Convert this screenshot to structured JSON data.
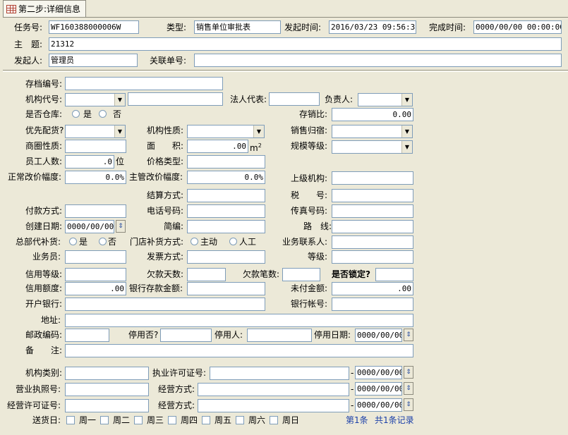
{
  "tab": {
    "title": "第二步:详细信息"
  },
  "header": {
    "task_no_label": "任务号:",
    "task_no": "WF160388000006W",
    "type_label": "类型:",
    "type": "销售单位审批表",
    "start_label": "发起时间:",
    "start_time": "2016/03/23 09:56:30",
    "finish_label": "完成时间:",
    "finish_time": "0000/00/00 00:00:00",
    "subject_label": "主　题:",
    "subject": "21312",
    "initiator_label": "发起人:",
    "initiator": "管理员",
    "related_label": "关联单号:",
    "related": ""
  },
  "form": {
    "archive_no": "存档编号:",
    "org_code": "机构代号:",
    "legal_rep": "法人代表:",
    "manager": "负责人:",
    "is_warehouse": "是否仓库:",
    "yes": "是",
    "no": "否",
    "stock_ratio": "存销比:",
    "stock_ratio_val": "0.00",
    "priority": "优先配货?",
    "org_nature": "机构性质:",
    "sales_attr": "销售归宿:",
    "district": "商圈性质:",
    "area": "面　　积:",
    "area_val": ".00",
    "area_unit": "m",
    "area_sup": "2",
    "scale": "规模等级:",
    "staff": "员工人数:",
    "staff_val": ".0",
    "staff_unit": "位",
    "price_type": "价格类型:",
    "normal_adj": "正常改价幅度:",
    "normal_adj_val": "0.0%",
    "sup_adj": "主管改价幅度:",
    "sup_adj_val": "0.0%",
    "parent": "上级机构:",
    "settle": "结算方式:",
    "tax": "税　　号:",
    "pay": "付款方式:",
    "phone": "电话号码:",
    "fax": "传真号码:",
    "created": "创建日期:",
    "created_val": "0000/00/00",
    "postal": "简编:",
    "route": "路　线:",
    "hq_replenish": "总部代补货:",
    "store_replenish": "门店补货方式:",
    "auto": "主动",
    "manual": "人工",
    "biz_contact": "业务联系人:",
    "salesman": "业务员:",
    "invoice": "发票方式:",
    "grade": "等级:",
    "credit_grade": "信用等级:",
    "overdue_days": "欠款天数:",
    "overdue_count": "欠款笔数:",
    "locked": "是否锁定?",
    "credit_limit": "信用额度:",
    "credit_limit_val": ".00",
    "bank_deposit": "银行存款金额:",
    "unpaid": "未付金额:",
    "unpaid_val": ".00",
    "bank": "开户银行:",
    "bank_account": "银行帐号:",
    "address": "地址:",
    "zip": "邮政编码:",
    "disabled": "停用否?",
    "disabled_by": "停用人:",
    "disabled_date": "停用日期:",
    "disabled_date_val": "0000/00/00",
    "remark": "备　　注:",
    "org_category": "机构类别:",
    "license_no": "执业许可证号:",
    "license_date": "0000/00/00",
    "biz_license": "营业执照号:",
    "biz_mode1": "经营方式:",
    "biz_license_date": "0000/00/00",
    "biz_permit": "经营许可证号:",
    "biz_mode2": "经营方式:",
    "biz_permit_date": "0000/00/00",
    "delivery": "送货日:",
    "days": [
      "周一",
      "周二",
      "周三",
      "周四",
      "周五",
      "周六",
      "周日"
    ],
    "record_no": "第1条",
    "record_total": "共1条记录"
  },
  "icons": {
    "spin": "up-down-spin-icon",
    "dropdown": "chevron-down-icon",
    "tab": "table-icon"
  }
}
